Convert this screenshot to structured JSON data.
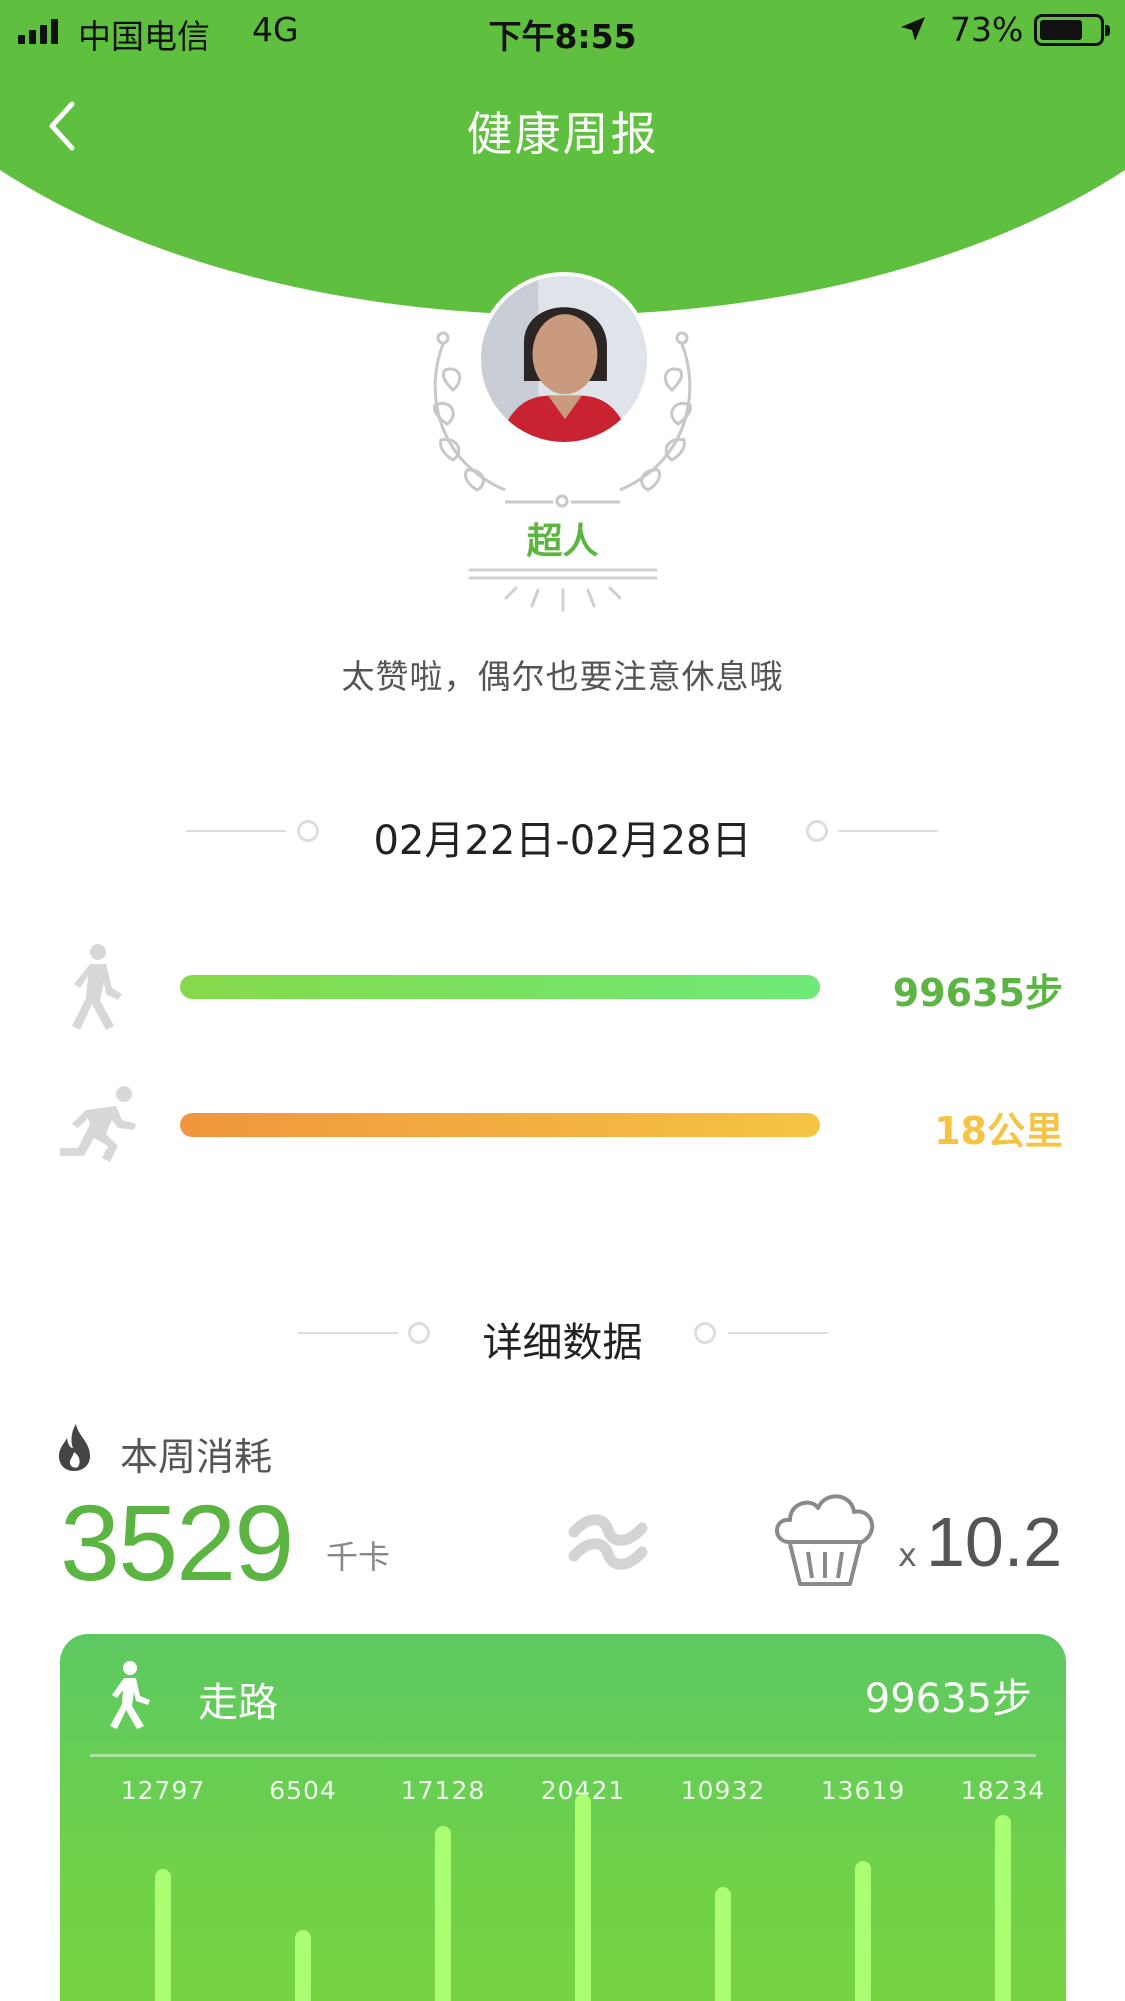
{
  "status_bar": {
    "carrier": "中国电信",
    "network": "4G",
    "time": "下午8:55",
    "battery_percent": "73%",
    "battery_level": 0.73
  },
  "header": {
    "title": "健康周报"
  },
  "profile": {
    "badge": "超人",
    "motto": "太赞啦，偶尔也要注意休息哦"
  },
  "week": {
    "range": "02月22日-02月28日",
    "steps_text": "99635步",
    "steps_fill": 1.0,
    "distance_text": "18公里",
    "distance_fill": 1.0
  },
  "details": {
    "heading": "详细数据",
    "calorie_label": "本周消耗",
    "calories": "3529",
    "calorie_unit": "千卡",
    "multiplier_prefix": "x",
    "multiplier": "10.2"
  },
  "walk_card": {
    "label": "走路",
    "total": "99635步",
    "daily_steps": [
      12797,
      6504,
      17128,
      20421,
      10932,
      13619,
      18234
    ]
  },
  "colors": {
    "brand_green": "#5fbf3f",
    "steps_text": "#5cb542",
    "distance_text": "#f5c443",
    "steps_gradient": [
      "#86d94a",
      "#6fea78"
    ],
    "distance_gradient": [
      "#f0963e",
      "#f5c443"
    ],
    "walk_bar": "#aaff73"
  },
  "icons": {
    "back": "chevron-left-icon",
    "location": "location-arrow-icon",
    "walk": "walking-person-icon",
    "run": "running-person-icon",
    "flame": "flame-icon",
    "approx": "approximately-equal-icon",
    "muffin": "muffin-icon"
  }
}
